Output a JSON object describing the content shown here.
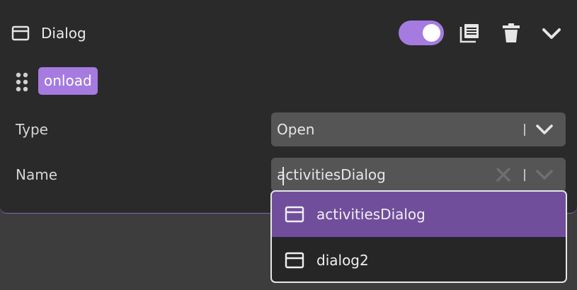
{
  "card": {
    "title": "Dialog",
    "title_icon": "dialog-window-icon",
    "enabled": true,
    "actions": [
      "duplicate-icon",
      "trash-icon",
      "chevron-down-icon"
    ]
  },
  "event": {
    "tag": "onload",
    "drag_icon": "drag-handle-icon"
  },
  "fields": {
    "type": {
      "label": "Type",
      "value": "Open"
    },
    "name": {
      "label": "Name",
      "value": "activitiesDialog"
    }
  },
  "dropdown": {
    "options": [
      {
        "label": "activitiesDialog",
        "icon": "dialog-window-icon",
        "selected": true
      },
      {
        "label": "dialog2",
        "icon": "dialog-window-icon",
        "selected": false
      }
    ]
  },
  "colors": {
    "accent": "#a57be0",
    "selected_option": "#714e9c",
    "panel_bg": "#2a2a2a",
    "page_bg": "#3d3d3d"
  }
}
